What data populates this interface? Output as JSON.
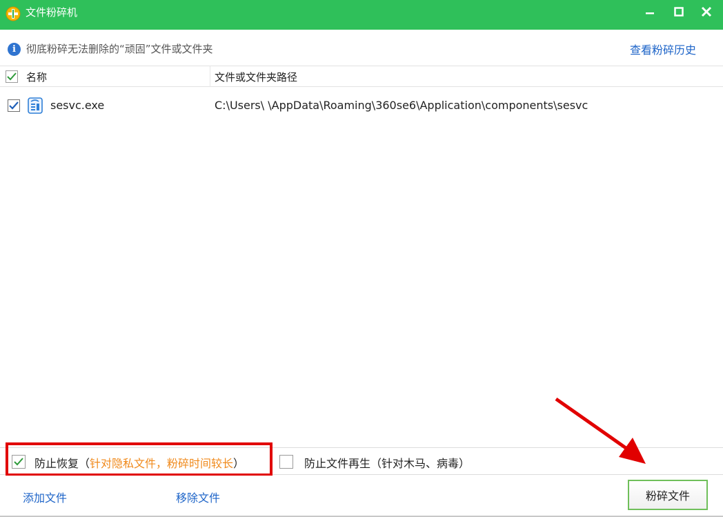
{
  "window": {
    "title": "文件粉碎机",
    "controls": {
      "minimize": "–",
      "maximize": "□",
      "close": "✕"
    }
  },
  "info": {
    "icon": "info-icon",
    "icon_glyph": "i",
    "text": "彻底粉碎无法删除的“顽固”文件或文件夹",
    "history_link": "查看粉碎历史"
  },
  "table": {
    "columns": [
      "名称",
      "文件或文件夹路径"
    ],
    "header_checked": true,
    "rows": [
      {
        "checked": true,
        "icon": "exe-file-icon",
        "name": "sesvc.exe",
        "path": "C:\\Users\\ \\AppData\\Roaming\\360se6\\Application\\components\\sesvc"
      }
    ]
  },
  "options": {
    "prevent_recovery": {
      "checked": true,
      "label": "防止恢复（",
      "note": "针对隐私文件，粉碎时间较长",
      "close": "）"
    },
    "prevent_regen": {
      "checked": false,
      "label": "防止文件再生（针对木马、病毒）"
    }
  },
  "actions": {
    "add_file": "添加文件",
    "remove_file": "移除文件",
    "shred": "粉碎文件"
  },
  "colors": {
    "titlebar": "#2fc05a",
    "link": "#1d64c8",
    "note": "#f08a1c",
    "annotation": "#e10000",
    "button_border": "#6fbf5a"
  }
}
